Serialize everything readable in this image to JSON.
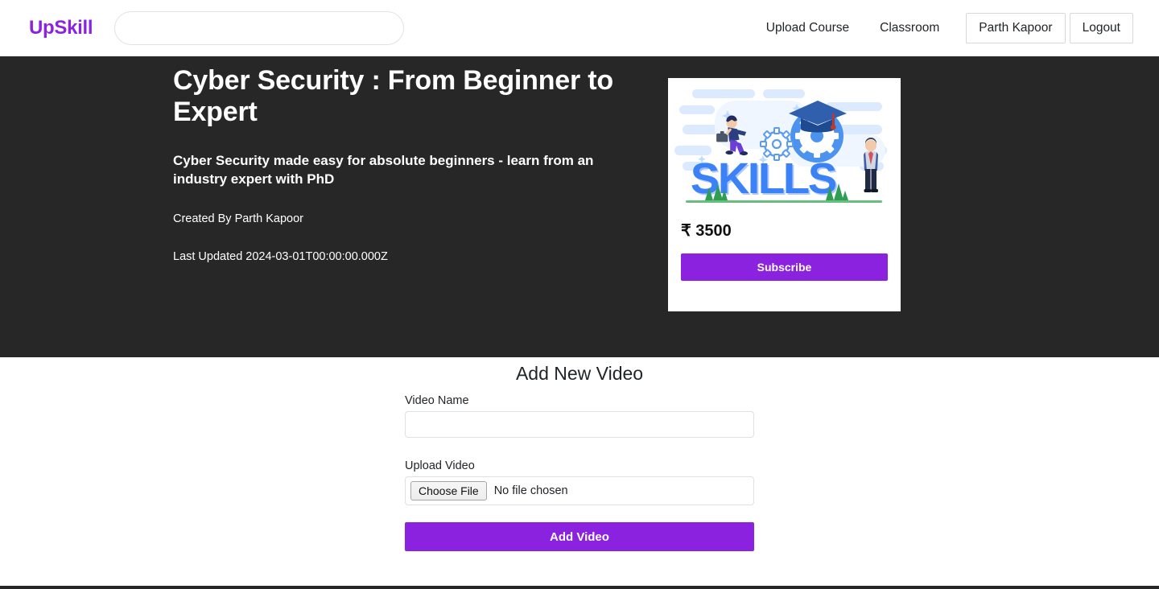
{
  "header": {
    "brand": "UpSkill",
    "search": {
      "value": "",
      "placeholder": ""
    },
    "nav_links": [
      {
        "label": "Upload Course",
        "name": "nav-link-upload-course"
      },
      {
        "label": "Classroom",
        "name": "nav-link-classroom"
      }
    ],
    "user_button": "Parth Kapoor",
    "logout_button": "Logout"
  },
  "hero": {
    "title": "Cyber Security : From Beginner to Expert",
    "subtitle": "Cyber Security made easy for absolute beginners - learn from an industry expert with PhD",
    "created_by": "Created By Parth Kapoor",
    "last_updated": "Last Updated 2024-03-01T00:00:00.000Z"
  },
  "course_card": {
    "art_alt": "skills-illustration",
    "price": "₹ 3500",
    "subscribe_label": "Subscribe"
  },
  "form": {
    "title": "Add New Video",
    "video_name_label": "Video Name",
    "video_name_value": "",
    "video_name_placeholder": "",
    "upload_video_label": "Upload Video",
    "choose_file_label": "Choose File",
    "file_status": "No file chosen",
    "submit_label": "Add Video"
  },
  "colors": {
    "accent_purple": "#8b22e0",
    "dark_background": "#272727",
    "page_background": "#ffffff",
    "text_primary": "#212529"
  }
}
